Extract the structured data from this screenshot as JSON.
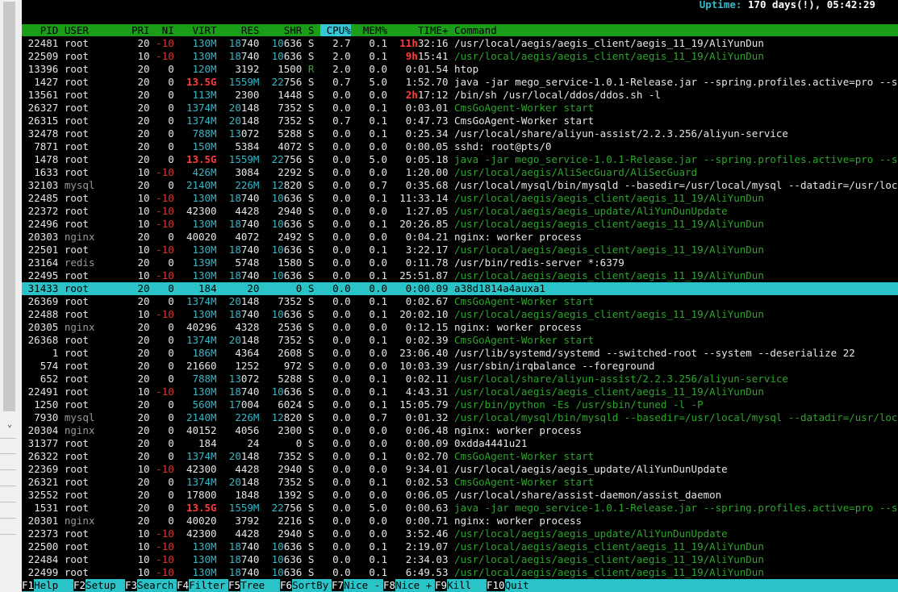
{
  "uptime": {
    "label": "Uptime: ",
    "value": "170 days(!), 05:42:29"
  },
  "columns": [
    "PID",
    "USER",
    "PRI",
    "NI",
    "VIRT",
    "RES",
    "SHR",
    "S",
    "CPU%",
    "MEM%",
    "TIME+",
    "Command"
  ],
  "sorted_column": "CPU%",
  "processes": [
    {
      "pid": "22481",
      "user": "root",
      "pri": "20",
      "ni": "-10",
      "virt": "130M",
      "res": "18740",
      "shr": "10636",
      "s": "S",
      "cpu": "2.7",
      "mem": "0.1",
      "time_h": "11h",
      "time_rest": "32:16",
      "cmd": "/usr/local/aegis/aegis_client/aegis_11_19/AliYunDun",
      "thread": false
    },
    {
      "pid": "22509",
      "user": "root",
      "pri": "10",
      "ni": "-10",
      "virt": "130M",
      "res": "18740",
      "shr": "10636",
      "s": "S",
      "cpu": "2.0",
      "mem": "0.1",
      "time_h": "9h",
      "time_rest": "15:41",
      "cmd": "/usr/local/aegis/aegis_client/aegis_11_19/AliYunDun",
      "thread": true
    },
    {
      "pid": "13396",
      "user": "root",
      "pri": "20",
      "ni": "0",
      "virt": "120M",
      "res": "3192",
      "shr": "1500",
      "s": "R",
      "cpu": "2.0",
      "mem": "0.0",
      "time_h": "",
      "time_rest": "0:01.54",
      "cmd": "htop",
      "thread": false
    },
    {
      "pid": "1427",
      "user": "root",
      "pri": "20",
      "ni": "0",
      "virt": "13.5G",
      "res": "1559M",
      "shr": "22756",
      "s": "S",
      "cpu": "0.7",
      "mem": "5.0",
      "time_h": "",
      "time_rest": "1:52.70",
      "cmd": "java -jar mego_service-1.0.1-Release.jar --spring.profiles.active=pro --s",
      "thread": false
    },
    {
      "pid": "13561",
      "user": "root",
      "pri": "20",
      "ni": "0",
      "virt": "113M",
      "res": "2300",
      "shr": "1448",
      "s": "S",
      "cpu": "0.0",
      "mem": "0.0",
      "time_h": "2h",
      "time_rest": "17:12",
      "cmd": "/bin/sh /usr/local/ddos/ddos.sh -l",
      "thread": false
    },
    {
      "pid": "26327",
      "user": "root",
      "pri": "20",
      "ni": "0",
      "virt": "1374M",
      "res": "20148",
      "shr": "7352",
      "s": "S",
      "cpu": "0.0",
      "mem": "0.1",
      "time_h": "",
      "time_rest": "0:03.01",
      "cmd": "CmsGoAgent-Worker start",
      "thread": true
    },
    {
      "pid": "26315",
      "user": "root",
      "pri": "20",
      "ni": "0",
      "virt": "1374M",
      "res": "20148",
      "shr": "7352",
      "s": "S",
      "cpu": "0.7",
      "mem": "0.1",
      "time_h": "",
      "time_rest": "0:47.73",
      "cmd": "CmsGoAgent-Worker start",
      "thread": false
    },
    {
      "pid": "32478",
      "user": "root",
      "pri": "20",
      "ni": "0",
      "virt": "788M",
      "res": "13072",
      "shr": "5288",
      "s": "S",
      "cpu": "0.0",
      "mem": "0.1",
      "time_h": "",
      "time_rest": "0:25.34",
      "cmd": "/usr/local/share/aliyun-assist/2.2.3.256/aliyun-service",
      "thread": false
    },
    {
      "pid": "7871",
      "user": "root",
      "pri": "20",
      "ni": "0",
      "virt": "150M",
      "res": "5384",
      "shr": "4072",
      "s": "S",
      "cpu": "0.0",
      "mem": "0.0",
      "time_h": "",
      "time_rest": "0:00.05",
      "cmd": "sshd: root@pts/0",
      "thread": false
    },
    {
      "pid": "1478",
      "user": "root",
      "pri": "20",
      "ni": "0",
      "virt": "13.5G",
      "res": "1559M",
      "shr": "22756",
      "s": "S",
      "cpu": "0.0",
      "mem": "5.0",
      "time_h": "",
      "time_rest": "0:05.18",
      "cmd": "java -jar mego_service-1.0.1-Release.jar --spring.profiles.active=pro --s",
      "thread": true
    },
    {
      "pid": "1633",
      "user": "root",
      "pri": "10",
      "ni": "-10",
      "virt": "426M",
      "res": "3084",
      "shr": "2292",
      "s": "S",
      "cpu": "0.0",
      "mem": "0.0",
      "time_h": "",
      "time_rest": "1:20.00",
      "cmd": "/usr/local/aegis/AliSecGuard/AliSecGuard",
      "thread": true
    },
    {
      "pid": "32103",
      "user": "mysql",
      "pri": "20",
      "ni": "0",
      "virt": "2140M",
      "res": "226M",
      "shr": "12820",
      "s": "S",
      "cpu": "0.0",
      "mem": "0.7",
      "time_h": "",
      "time_rest": "0:35.68",
      "cmd": "/usr/local/mysql/bin/mysqld --basedir=/usr/local/mysql --datadir=/usr/loc",
      "thread": false
    },
    {
      "pid": "22485",
      "user": "root",
      "pri": "10",
      "ni": "-10",
      "virt": "130M",
      "res": "18740",
      "shr": "10636",
      "s": "S",
      "cpu": "0.0",
      "mem": "0.1",
      "time_h": "",
      "time_rest": "11:33.14",
      "cmd": "/usr/local/aegis/aegis_client/aegis_11_19/AliYunDun",
      "thread": true
    },
    {
      "pid": "22372",
      "user": "root",
      "pri": "10",
      "ni": "-10",
      "virt": "42300",
      "res": "4428",
      "shr": "2940",
      "s": "S",
      "cpu": "0.0",
      "mem": "0.0",
      "time_h": "",
      "time_rest": "1:27.05",
      "cmd": "/usr/local/aegis/aegis_update/AliYunDunUpdate",
      "thread": true
    },
    {
      "pid": "22496",
      "user": "root",
      "pri": "10",
      "ni": "-10",
      "virt": "130M",
      "res": "18740",
      "shr": "10636",
      "s": "S",
      "cpu": "0.0",
      "mem": "0.1",
      "time_h": "",
      "time_rest": "20:26.85",
      "cmd": "/usr/local/aegis/aegis_client/aegis_11_19/AliYunDun",
      "thread": true
    },
    {
      "pid": "20303",
      "user": "nginx",
      "pri": "20",
      "ni": "0",
      "virt": "40020",
      "res": "4072",
      "shr": "2492",
      "s": "S",
      "cpu": "0.0",
      "mem": "0.0",
      "time_h": "",
      "time_rest": "0:04.21",
      "cmd": "nginx: worker process",
      "thread": false
    },
    {
      "pid": "22501",
      "user": "root",
      "pri": "10",
      "ni": "-10",
      "virt": "130M",
      "res": "18740",
      "shr": "10636",
      "s": "S",
      "cpu": "0.0",
      "mem": "0.1",
      "time_h": "",
      "time_rest": "3:22.17",
      "cmd": "/usr/local/aegis/aegis_client/aegis_11_19/AliYunDun",
      "thread": true
    },
    {
      "pid": "23164",
      "user": "redis",
      "pri": "20",
      "ni": "0",
      "virt": "139M",
      "res": "5748",
      "shr": "1580",
      "s": "S",
      "cpu": "0.0",
      "mem": "0.0",
      "time_h": "",
      "time_rest": "0:11.78",
      "cmd": "/usr/bin/redis-server *:6379",
      "thread": false
    },
    {
      "pid": "22495",
      "user": "root",
      "pri": "10",
      "ni": "-10",
      "virt": "130M",
      "res": "18740",
      "shr": "10636",
      "s": "S",
      "cpu": "0.0",
      "mem": "0.1",
      "time_h": "",
      "time_rest": "25:51.87",
      "cmd": "/usr/local/aegis/aegis_client/aegis_11_19/AliYunDun",
      "thread": true
    },
    {
      "pid": "31433",
      "user": "root",
      "pri": "20",
      "ni": "0",
      "virt": "184",
      "res": "20",
      "shr": "0",
      "s": "S",
      "cpu": "0.0",
      "mem": "0.0",
      "time_h": "",
      "time_rest": "0:00.09",
      "cmd": "a38d1814a4auxa1",
      "thread": false,
      "selected": true
    },
    {
      "pid": "26369",
      "user": "root",
      "pri": "20",
      "ni": "0",
      "virt": "1374M",
      "res": "20148",
      "shr": "7352",
      "s": "S",
      "cpu": "0.0",
      "mem": "0.1",
      "time_h": "",
      "time_rest": "0:02.67",
      "cmd": "CmsGoAgent-Worker start",
      "thread": true
    },
    {
      "pid": "22488",
      "user": "root",
      "pri": "10",
      "ni": "-10",
      "virt": "130M",
      "res": "18740",
      "shr": "10636",
      "s": "S",
      "cpu": "0.0",
      "mem": "0.1",
      "time_h": "",
      "time_rest": "20:02.10",
      "cmd": "/usr/local/aegis/aegis_client/aegis_11_19/AliYunDun",
      "thread": true
    },
    {
      "pid": "20305",
      "user": "nginx",
      "pri": "20",
      "ni": "0",
      "virt": "40296",
      "res": "4328",
      "shr": "2536",
      "s": "S",
      "cpu": "0.0",
      "mem": "0.0",
      "time_h": "",
      "time_rest": "0:12.15",
      "cmd": "nginx: worker process",
      "thread": false
    },
    {
      "pid": "26368",
      "user": "root",
      "pri": "20",
      "ni": "0",
      "virt": "1374M",
      "res": "20148",
      "shr": "7352",
      "s": "S",
      "cpu": "0.0",
      "mem": "0.1",
      "time_h": "",
      "time_rest": "0:02.39",
      "cmd": "CmsGoAgent-Worker start",
      "thread": true
    },
    {
      "pid": "1",
      "user": "root",
      "pri": "20",
      "ni": "0",
      "virt": "186M",
      "res": "4364",
      "shr": "2608",
      "s": "S",
      "cpu": "0.0",
      "mem": "0.0",
      "time_h": "",
      "time_rest": "23:06.40",
      "cmd": "/usr/lib/systemd/systemd --switched-root --system --deserialize 22",
      "thread": false
    },
    {
      "pid": "574",
      "user": "root",
      "pri": "20",
      "ni": "0",
      "virt": "21660",
      "res": "1252",
      "shr": "972",
      "s": "S",
      "cpu": "0.0",
      "mem": "0.0",
      "time_h": "",
      "time_rest": "10:03.39",
      "cmd": "/usr/sbin/irqbalance --foreground",
      "thread": false
    },
    {
      "pid": "652",
      "user": "root",
      "pri": "20",
      "ni": "0",
      "virt": "788M",
      "res": "13072",
      "shr": "5288",
      "s": "S",
      "cpu": "0.0",
      "mem": "0.1",
      "time_h": "",
      "time_rest": "0:02.11",
      "cmd": "/usr/local/share/aliyun-assist/2.2.3.256/aliyun-service",
      "thread": true
    },
    {
      "pid": "22491",
      "user": "root",
      "pri": "10",
      "ni": "-10",
      "virt": "130M",
      "res": "18740",
      "shr": "10636",
      "s": "S",
      "cpu": "0.0",
      "mem": "0.1",
      "time_h": "",
      "time_rest": "4:43.31",
      "cmd": "/usr/local/aegis/aegis_client/aegis_11_19/AliYunDun",
      "thread": true
    },
    {
      "pid": "1250",
      "user": "root",
      "pri": "20",
      "ni": "0",
      "virt": "560M",
      "res": "17004",
      "shr": "6024",
      "s": "S",
      "cpu": "0.0",
      "mem": "0.1",
      "time_h": "",
      "time_rest": "15:05.79",
      "cmd": "/usr/bin/python -Es /usr/sbin/tuned -l -P",
      "thread": true
    },
    {
      "pid": "7930",
      "user": "mysql",
      "pri": "20",
      "ni": "0",
      "virt": "2140M",
      "res": "226M",
      "shr": "12820",
      "s": "S",
      "cpu": "0.0",
      "mem": "0.7",
      "time_h": "",
      "time_rest": "0:01.32",
      "cmd": "/usr/local/mysql/bin/mysqld --basedir=/usr/local/mysql --datadir=/usr/loc",
      "thread": true
    },
    {
      "pid": "20304",
      "user": "nginx",
      "pri": "20",
      "ni": "0",
      "virt": "40152",
      "res": "4056",
      "shr": "2300",
      "s": "S",
      "cpu": "0.0",
      "mem": "0.0",
      "time_h": "",
      "time_rest": "0:06.48",
      "cmd": "nginx: worker process",
      "thread": false
    },
    {
      "pid": "31377",
      "user": "root",
      "pri": "20",
      "ni": "0",
      "virt": "184",
      "res": "24",
      "shr": "0",
      "s": "S",
      "cpu": "0.0",
      "mem": "0.0",
      "time_h": "",
      "time_rest": "0:00.09",
      "cmd": "0xdda4441u21",
      "thread": false
    },
    {
      "pid": "26322",
      "user": "root",
      "pri": "20",
      "ni": "0",
      "virt": "1374M",
      "res": "20148",
      "shr": "7352",
      "s": "S",
      "cpu": "0.0",
      "mem": "0.1",
      "time_h": "",
      "time_rest": "0:02.70",
      "cmd": "CmsGoAgent-Worker start",
      "thread": true
    },
    {
      "pid": "22369",
      "user": "root",
      "pri": "10",
      "ni": "-10",
      "virt": "42300",
      "res": "4428",
      "shr": "2940",
      "s": "S",
      "cpu": "0.0",
      "mem": "0.0",
      "time_h": "",
      "time_rest": "9:34.01",
      "cmd": "/usr/local/aegis/aegis_update/AliYunDunUpdate",
      "thread": false
    },
    {
      "pid": "26321",
      "user": "root",
      "pri": "20",
      "ni": "0",
      "virt": "1374M",
      "res": "20148",
      "shr": "7352",
      "s": "S",
      "cpu": "0.0",
      "mem": "0.1",
      "time_h": "",
      "time_rest": "0:02.53",
      "cmd": "CmsGoAgent-Worker start",
      "thread": true
    },
    {
      "pid": "32552",
      "user": "root",
      "pri": "20",
      "ni": "0",
      "virt": "17800",
      "res": "1848",
      "shr": "1392",
      "s": "S",
      "cpu": "0.0",
      "mem": "0.0",
      "time_h": "",
      "time_rest": "0:06.05",
      "cmd": "/usr/local/share/assist-daemon/assist_daemon",
      "thread": false
    },
    {
      "pid": "1531",
      "user": "root",
      "pri": "20",
      "ni": "0",
      "virt": "13.5G",
      "res": "1559M",
      "shr": "22756",
      "s": "S",
      "cpu": "0.0",
      "mem": "5.0",
      "time_h": "",
      "time_rest": "0:00.63",
      "cmd": "java -jar mego_service-1.0.1-Release.jar --spring.profiles.active=pro --s",
      "thread": true
    },
    {
      "pid": "20301",
      "user": "nginx",
      "pri": "20",
      "ni": "0",
      "virt": "40020",
      "res": "3792",
      "shr": "2216",
      "s": "S",
      "cpu": "0.0",
      "mem": "0.0",
      "time_h": "",
      "time_rest": "0:00.71",
      "cmd": "nginx: worker process",
      "thread": false
    },
    {
      "pid": "22373",
      "user": "root",
      "pri": "10",
      "ni": "-10",
      "virt": "42300",
      "res": "4428",
      "shr": "2940",
      "s": "S",
      "cpu": "0.0",
      "mem": "0.0",
      "time_h": "",
      "time_rest": "3:52.46",
      "cmd": "/usr/local/aegis/aegis_update/AliYunDunUpdate",
      "thread": true
    },
    {
      "pid": "22500",
      "user": "root",
      "pri": "10",
      "ni": "-10",
      "virt": "130M",
      "res": "18740",
      "shr": "10636",
      "s": "S",
      "cpu": "0.0",
      "mem": "0.1",
      "time_h": "",
      "time_rest": "2:19.07",
      "cmd": "/usr/local/aegis/aegis_client/aegis_11_19/AliYunDun",
      "thread": true
    },
    {
      "pid": "22484",
      "user": "root",
      "pri": "10",
      "ni": "-10",
      "virt": "130M",
      "res": "18740",
      "shr": "10636",
      "s": "S",
      "cpu": "0.0",
      "mem": "0.1",
      "time_h": "",
      "time_rest": "2:34.03",
      "cmd": "/usr/local/aegis/aegis_client/aegis_11_19/AliYunDun",
      "thread": true
    },
    {
      "pid": "22499",
      "user": "root",
      "pri": "10",
      "ni": "-10",
      "virt": "130M",
      "res": "18740",
      "shr": "10636",
      "s": "S",
      "cpu": "0.0",
      "mem": "0.1",
      "time_h": "",
      "time_rest": "6:49.53",
      "cmd": "/usr/local/aegis/aegis_client/aegis_11_19/AliYunDun",
      "thread": true
    }
  ],
  "function_keys": [
    {
      "key": "F1",
      "label": "Help"
    },
    {
      "key": "F2",
      "label": "Setup"
    },
    {
      "key": "F3",
      "label": "Search"
    },
    {
      "key": "F4",
      "label": "Filter"
    },
    {
      "key": "F5",
      "label": "Tree"
    },
    {
      "key": "F6",
      "label": "SortBy"
    },
    {
      "key": "F7",
      "label": "Nice -"
    },
    {
      "key": "F8",
      "label": "Nice +"
    },
    {
      "key": "F9",
      "label": "Kill"
    },
    {
      "key": "F10",
      "label": "Quit"
    }
  ],
  "colors": {
    "header_bg": "#1a9e1a",
    "selected_bg": "#2ac4c8",
    "thread_text": "#2da52d",
    "nice_text": "#e53030",
    "uptime_text": "#35b8c9"
  },
  "scroll_icon": "chevron-down-icon"
}
